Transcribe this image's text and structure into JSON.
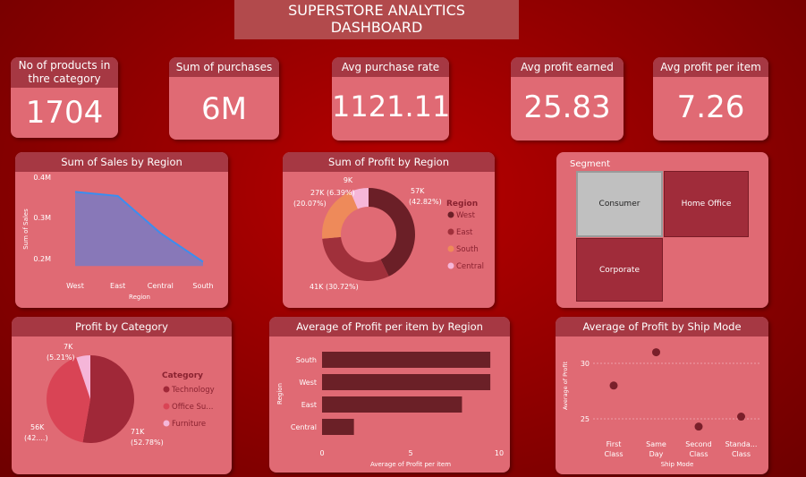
{
  "header": {
    "title_line1": "SUPERSTORE ANALYTICS",
    "title_line2": "DASHBOARD"
  },
  "kpis": [
    {
      "label": "No of products in thre category",
      "label_line1": "No of products in",
      "label_line2": "thre category",
      "value": "1704"
    },
    {
      "label": "Sum of purchases",
      "value": "6M"
    },
    {
      "label": "Avg purchase rate",
      "value": "1121.11"
    },
    {
      "label": "Avg profit earned",
      "value": "25.83"
    },
    {
      "label": "Avg profit per item",
      "value": "7.26"
    }
  ],
  "colors": {
    "card": "#e06a74",
    "header": "#a63843",
    "west": "#6b1f27",
    "east": "#a0303b",
    "south": "#ee8a5a",
    "central": "#f6b6d8",
    "technology": "#a02838",
    "office": "#d94455",
    "furniture": "#f5b6d9",
    "bar": "#6b2027",
    "line": "#3a8ef0",
    "area": "#8878b8"
  },
  "charts": {
    "sales_region": {
      "title": "Sum of Sales by Region",
      "xlabel": "Region",
      "ylabel": "Sum of Sales",
      "yticks": [
        "0.4M",
        "0.3M",
        "0.2M"
      ]
    },
    "profit_region": {
      "title": "Sum of Profit by Region",
      "legend_title": "Region",
      "labels": {
        "west": "57K (42.82%)",
        "west_l1": "57K",
        "west_l2": "(42.82%)",
        "east": "41K (30.72%)",
        "south_l1": "27K (6.39%)",
        "south_l2": "(20.07%)",
        "central": "9K"
      }
    },
    "segment": {
      "title": "Segment",
      "tiles": [
        "Consumer",
        "Home Office",
        "Corporate"
      ]
    },
    "profit_category": {
      "title": "Profit by Category",
      "legend_title": "Category",
      "legend_items": [
        "Technology",
        "Office Su...",
        "Furniture"
      ],
      "labels": {
        "furniture_l1": "7K",
        "furniture_l2": "(5.21%)",
        "office_l1": "56K",
        "office_l2": "(42....)",
        "tech_l1": "71K",
        "tech_l2": "(52.78%)"
      }
    },
    "avg_profit_region": {
      "title": "Average of Profit per item by Region",
      "xlabel": "Average of Profit per item",
      "ylabel": "Region",
      "xticks": [
        "0",
        "5",
        "10"
      ]
    },
    "ship_mode": {
      "title": "Average of Profit by Ship Mode",
      "xlabel": "Ship Mode",
      "ylabel": "Average of Profit",
      "yticks": [
        "30",
        "25"
      ],
      "categories": [
        {
          "l1": "First",
          "l2": "Class"
        },
        {
          "l1": "Same",
          "l2": "Day"
        },
        {
          "l1": "Second",
          "l2": "Class"
        },
        {
          "l1": "Standa...",
          "l2": "Class"
        }
      ]
    }
  },
  "chart_data": [
    {
      "type": "area",
      "title": "Sum of Sales by Region",
      "categories": [
        "West",
        "East",
        "Central",
        "South"
      ],
      "values": [
        0.36,
        0.35,
        0.26,
        0.19
      ],
      "xlabel": "Region",
      "ylabel": "Sum of Sales",
      "ylim": [
        0.15,
        0.4
      ],
      "unit": "M"
    },
    {
      "type": "pie",
      "title": "Sum of Profit by Region",
      "categories": [
        "West",
        "East",
        "South",
        "Central"
      ],
      "values": [
        42.82,
        30.72,
        20.07,
        6.39
      ]
    },
    {
      "type": "pie",
      "title": "Profit by Category",
      "categories": [
        "Technology",
        "Office Supplies",
        "Furniture"
      ],
      "values": [
        52.78,
        42.01,
        5.21
      ]
    },
    {
      "type": "bar",
      "title": "Average of Profit per item by Region",
      "categories": [
        "South",
        "West",
        "East",
        "Central"
      ],
      "values": [
        9.5,
        9.5,
        7.9,
        1.8
      ],
      "xlim": [
        0,
        10
      ]
    },
    {
      "type": "scatter",
      "title": "Average of Profit by Ship Mode",
      "categories": [
        "First Class",
        "Same Day",
        "Second Class",
        "Standard Class"
      ],
      "values": [
        28.0,
        31.0,
        24.3,
        25.2
      ],
      "ylim": [
        23.5,
        32
      ]
    }
  ]
}
